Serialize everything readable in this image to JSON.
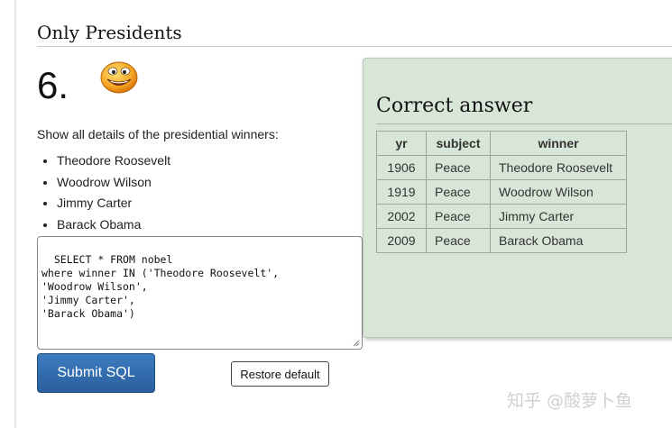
{
  "section": {
    "title": "Only Presidents"
  },
  "question": {
    "number": "6.",
    "prompt": "Show all details of the presidential winners:",
    "items": [
      "Theodore Roosevelt",
      "Woodrow Wilson",
      "Jimmy Carter",
      "Barack Obama"
    ]
  },
  "editor": {
    "sql": "SELECT * FROM nobel\nwhere winner IN ('Theodore Roosevelt',\n'Woodrow Wilson',\n'Jimmy Carter',\n'Barack Obama')"
  },
  "buttons": {
    "submit_label": "Submit SQL",
    "restore_label": "Restore default"
  },
  "answer": {
    "title": "Correct answer",
    "columns": [
      "yr",
      "subject",
      "winner"
    ],
    "rows": [
      [
        "1906",
        "Peace",
        "Theodore Roosevelt"
      ],
      [
        "1919",
        "Peace",
        "Woodrow Wilson"
      ],
      [
        "2002",
        "Peace",
        "Jimmy Carter"
      ],
      [
        "2009",
        "Peace",
        "Barack Obama"
      ]
    ]
  },
  "watermark": "知乎 @酸萝卜鱼",
  "colors": {
    "submit_bg": "#2f6aab",
    "answer_panel_bg": "#d8e6d8",
    "smiley": "#f5a623"
  },
  "icons": {
    "status": "smiley-icon"
  }
}
